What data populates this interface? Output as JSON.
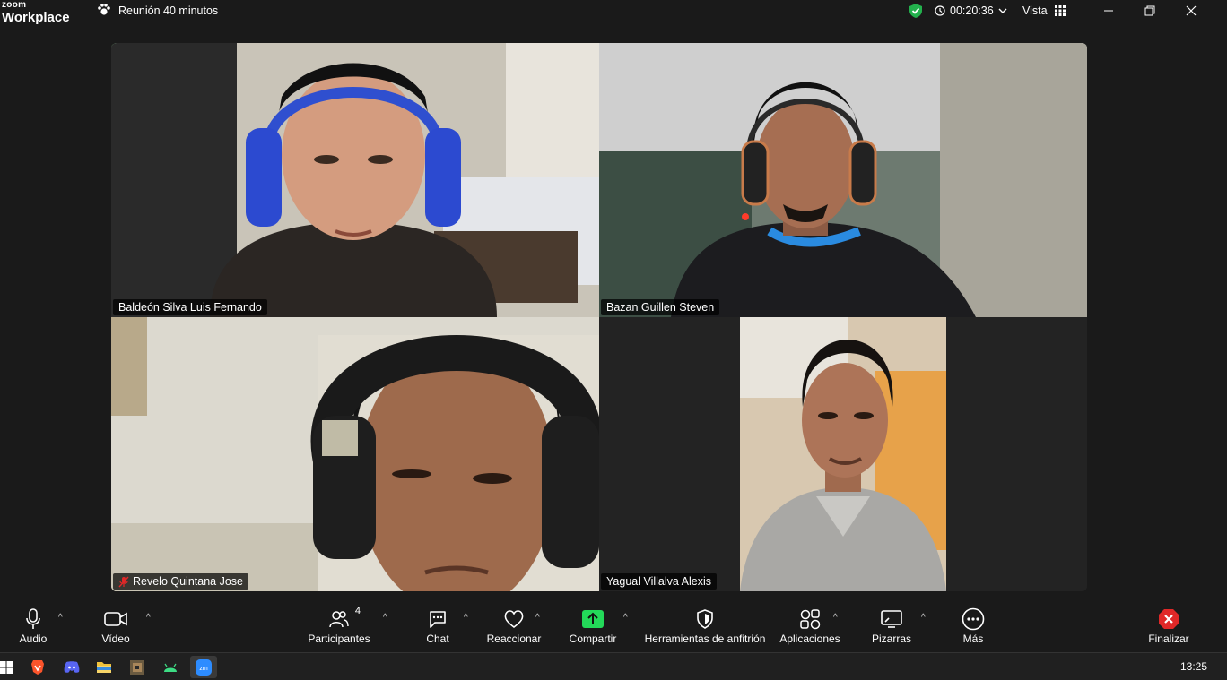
{
  "app": {
    "brand_small": "zoom",
    "brand_large": "Workplace"
  },
  "meeting": {
    "title": "Reunión 40 minutos",
    "timer": "00:20:36",
    "view_label": "Vista"
  },
  "participants": [
    {
      "name": "Baldeón Silva Luis Fernando",
      "active_speaker": true,
      "muted": false
    },
    {
      "name": "Bazan Guillen Steven",
      "active_speaker": false,
      "muted": false
    },
    {
      "name": "Revelo Quintana Jose",
      "active_speaker": false,
      "muted": true
    },
    {
      "name": "Yagual Villalva Alexis",
      "active_speaker": false,
      "muted": false
    }
  ],
  "toolbar": {
    "audio": "Audio",
    "video": "Vídeo",
    "participants": "Participantes",
    "participants_count": "4",
    "chat": "Chat",
    "react": "Reaccionar",
    "share": "Compartir",
    "host_tools": "Herramientas de anfitrión",
    "apps": "Aplicaciones",
    "whiteboards": "Pizarras",
    "more": "Más",
    "end": "Finalizar"
  },
  "taskbar": {
    "apps": [
      "windows-start",
      "brave-browser",
      "discord",
      "file-explorer",
      "game-app",
      "android-app",
      "zoom"
    ],
    "clock": "13:25"
  },
  "colors": {
    "active_border": "#23d959",
    "share_green": "#23d959",
    "end_red": "#e02828"
  }
}
